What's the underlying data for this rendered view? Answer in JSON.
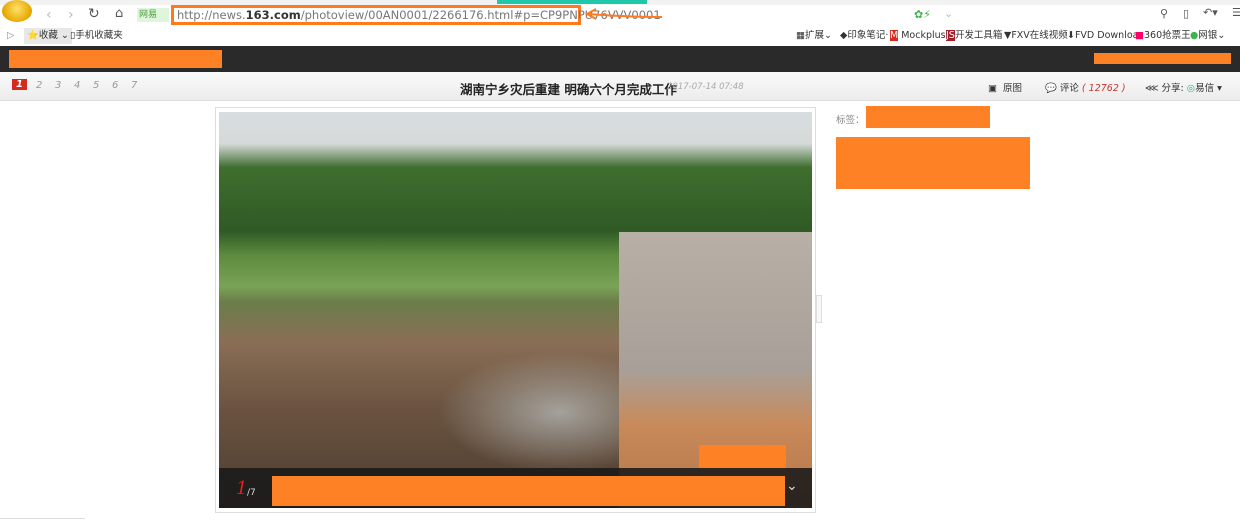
{
  "browser": {
    "url_prefix": "http://news.",
    "url_domain": "163.com",
    "url_rest": "/photoview/00AN0001/2266176.html#p=CP9PNPU76VVV0001",
    "site_badge": "网易",
    "bookmarks_left": [
      {
        "label": "收藏"
      },
      {
        "label": "手机收藏夹"
      }
    ],
    "bookmarks_right": [
      {
        "label": "扩展"
      },
      {
        "label": "印象笔记·"
      },
      {
        "label": "Mockplus"
      },
      {
        "label": "开发工具箱"
      },
      {
        "label": "FXV在线视频"
      },
      {
        "label": "FVD Downloa"
      },
      {
        "label": "360抢票王"
      },
      {
        "label": "网银"
      }
    ]
  },
  "page": {
    "pages": [
      "1",
      "2",
      "3",
      "4",
      "5",
      "6",
      "7"
    ],
    "title": "湖南宁乡灾后重建 明确六个月完成工作",
    "date": "2017-07-14 07:48",
    "original_label": "原图",
    "comment_label": "评论",
    "comment_count": "12762",
    "share_label": "分享:",
    "share_target": "易信",
    "tags_label": "标签：",
    "caption_current": "1",
    "caption_total": "7"
  },
  "colors": {
    "accent": "#ff8126",
    "highlight": "#ff7a1f",
    "page_active": "#d52b1e"
  }
}
